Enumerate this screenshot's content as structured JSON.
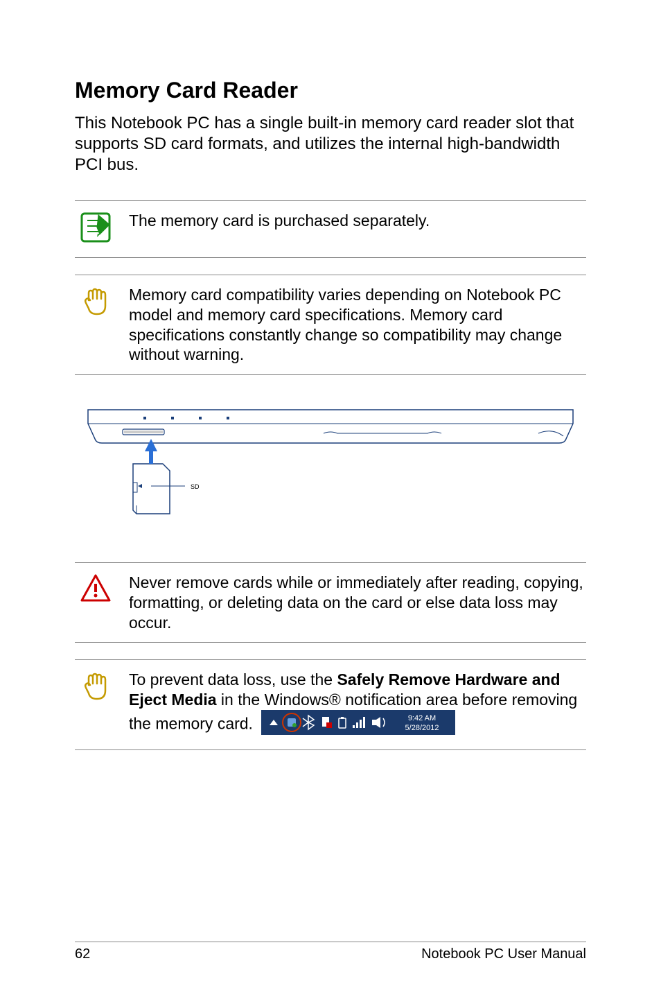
{
  "heading": "Memory Card Reader",
  "intro": "This Notebook PC has a single built-in memory card reader slot that supports SD card formats, and utilizes the internal high-bandwidth PCI bus.",
  "note_purchased": "The memory card is purchased separately.",
  "note_compatibility": "Memory card compatibility varies depending on Notebook PC model and memory card specifications. Memory card specifications constantly change so compatibility may change without warning.",
  "diagram": {
    "sd_label": "SD"
  },
  "warning_remove": "Never remove cards while or immediately after reading, copying, formatting, or deleting data on the card or else data loss may occur.",
  "tip_prefix": "To prevent data loss, use the ",
  "tip_bold": "Safely Remove Hardware and Eject Media",
  "tip_suffix1": " in the Windows® notification area  before removing the memory card.",
  "systray": {
    "time": "9:42 AM",
    "date": "5/28/2012"
  },
  "footer": {
    "page": "62",
    "title": "Notebook PC User Manual"
  }
}
